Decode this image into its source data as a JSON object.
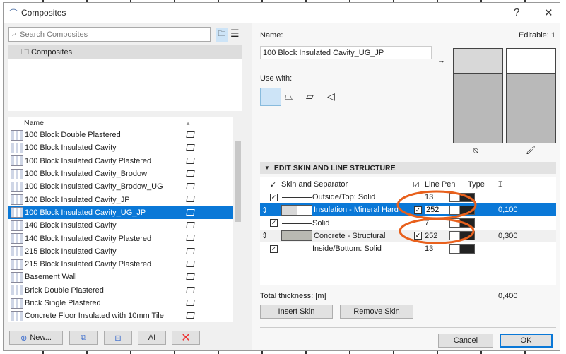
{
  "window": {
    "title": "Composites",
    "help": "?",
    "close": "✕"
  },
  "left": {
    "search_placeholder": "Search Composites",
    "tree_root": "Composites",
    "column_name": "Name",
    "items": [
      {
        "name": "100 Block Double Plastered",
        "selected": false
      },
      {
        "name": "100 Block Insulated Cavity",
        "selected": false
      },
      {
        "name": "100 Block Insulated Cavity Plastered",
        "selected": false
      },
      {
        "name": "100 Block Insulated Cavity_Brodow",
        "selected": false
      },
      {
        "name": "100 Block Insulated Cavity_Brodow_UG",
        "selected": false
      },
      {
        "name": "100 Block Insulated Cavity_JP",
        "selected": false
      },
      {
        "name": "100 Block Insulated Cavity_UG_JP",
        "selected": true
      },
      {
        "name": "140 Block Insulated Cavity",
        "selected": false
      },
      {
        "name": "140 Block Insulated Cavity Plastered",
        "selected": false
      },
      {
        "name": "215 Block Insulated Cavity",
        "selected": false
      },
      {
        "name": "215 Block Insulated Cavity Plastered",
        "selected": false
      },
      {
        "name": "Basement Wall",
        "selected": false
      },
      {
        "name": "Brick Double Plastered",
        "selected": false
      },
      {
        "name": "Brick Single Plastered",
        "selected": false
      },
      {
        "name": "Concrete Floor Insulated with 10mm Tile",
        "selected": false
      }
    ],
    "new_button": "New...",
    "rename_icon_text": "AI"
  },
  "right": {
    "name_label": "Name:",
    "editable": "Editable: 1",
    "name_value": "100 Block Insulated Cavity_UG_JP",
    "use_with": "Use with:",
    "section_title": "EDIT SKIN AND LINE STRUCTURE",
    "headers": {
      "skin": "Skin and Separator",
      "pen": "Line Pen",
      "type": "Type"
    },
    "rows": [
      {
        "kind": "line",
        "label": "Outside/Top: Solid",
        "pen": "13"
      },
      {
        "kind": "skin",
        "label": "Insulation - Mineral Hard",
        "pen": "252",
        "thickness": "0,100",
        "selected": true
      },
      {
        "kind": "line",
        "label": "Solid",
        "pen": "7"
      },
      {
        "kind": "skin",
        "label": "Concrete - Structural",
        "pen": "252",
        "thickness": "0,300",
        "selected": false
      },
      {
        "kind": "line",
        "label": "Inside/Bottom: Solid",
        "pen": "13"
      }
    ],
    "total_label": "Total thickness: [m]",
    "total_value": "0,400",
    "insert_skin": "Insert Skin",
    "remove_skin": "Remove Skin",
    "cancel": "Cancel",
    "ok": "OK"
  },
  "colors": {
    "selection": "#0a78d7",
    "annotation": "#e8601c"
  }
}
